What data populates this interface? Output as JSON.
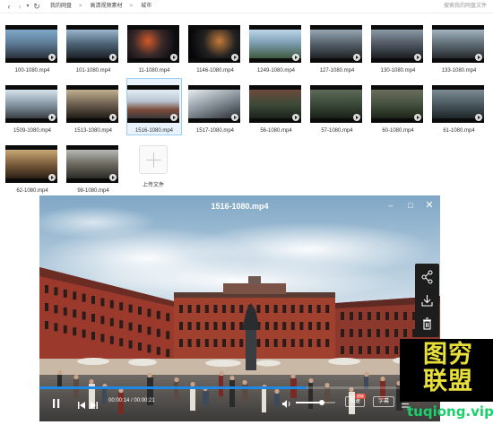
{
  "topbar": {
    "breadcrumbs": [
      "我的网盘",
      "高清视频素材",
      "城市"
    ],
    "search_placeholder": "搜索我的网盘文件",
    "icons": {
      "back": "chevron-left-icon",
      "forward": "chevron-right-icon",
      "dropdown": "caret-down-icon",
      "refresh": "refresh-icon"
    }
  },
  "files": [
    {
      "name": "100-1080.mp4",
      "scene": "s1",
      "selected": false
    },
    {
      "name": "101-1080.mp4",
      "scene": "s2",
      "selected": false
    },
    {
      "name": "11-1080.mp4",
      "scene": "s3",
      "selected": false
    },
    {
      "name": "1146-1080.mp4",
      "scene": "s4",
      "selected": false
    },
    {
      "name": "1249-1080.mp4",
      "scene": "s5",
      "selected": false
    },
    {
      "name": "127-1080.mp4",
      "scene": "s6",
      "selected": false
    },
    {
      "name": "130-1080.mp4",
      "scene": "s7",
      "selected": false
    },
    {
      "name": "133-1080.mp4",
      "scene": "s8",
      "selected": false
    },
    {
      "name": "1509-1080.mp4",
      "scene": "s9",
      "selected": false
    },
    {
      "name": "1513-1080.mp4",
      "scene": "s10",
      "selected": false
    },
    {
      "name": "1516-1080.mp4",
      "scene": "s11",
      "selected": true
    },
    {
      "name": "1517-1080.mp4",
      "scene": "s12",
      "selected": false
    },
    {
      "name": "56-1080.mp4",
      "scene": "s13",
      "selected": false
    },
    {
      "name": "57-1080.mp4",
      "scene": "s14",
      "selected": false
    },
    {
      "name": "60-1080.mp4",
      "scene": "s15",
      "selected": false
    },
    {
      "name": "61-1080.mp4",
      "scene": "s16",
      "selected": false
    },
    {
      "name": "62-1080.mp4",
      "scene": "s17",
      "selected": false
    },
    {
      "name": "98-1080.mp4",
      "scene": "s18",
      "selected": false
    }
  ],
  "upload": {
    "label": "上传文件"
  },
  "player": {
    "title": "1516-1080.mp4",
    "window_buttons": [
      "minimize-icon",
      "maximize-icon",
      "close-icon"
    ],
    "side_tools": [
      "share-icon",
      "download-icon",
      "delete-icon"
    ],
    "current_time": "00:00:14",
    "total_time": "00:00:21",
    "progress": 0.667,
    "volume": 0.65,
    "speed_label": "倍速",
    "speed_tag": "超级",
    "subtitle_label": "字幕"
  },
  "watermark": {
    "text": "图穷联盟",
    "url": "tuqiong.vip"
  }
}
